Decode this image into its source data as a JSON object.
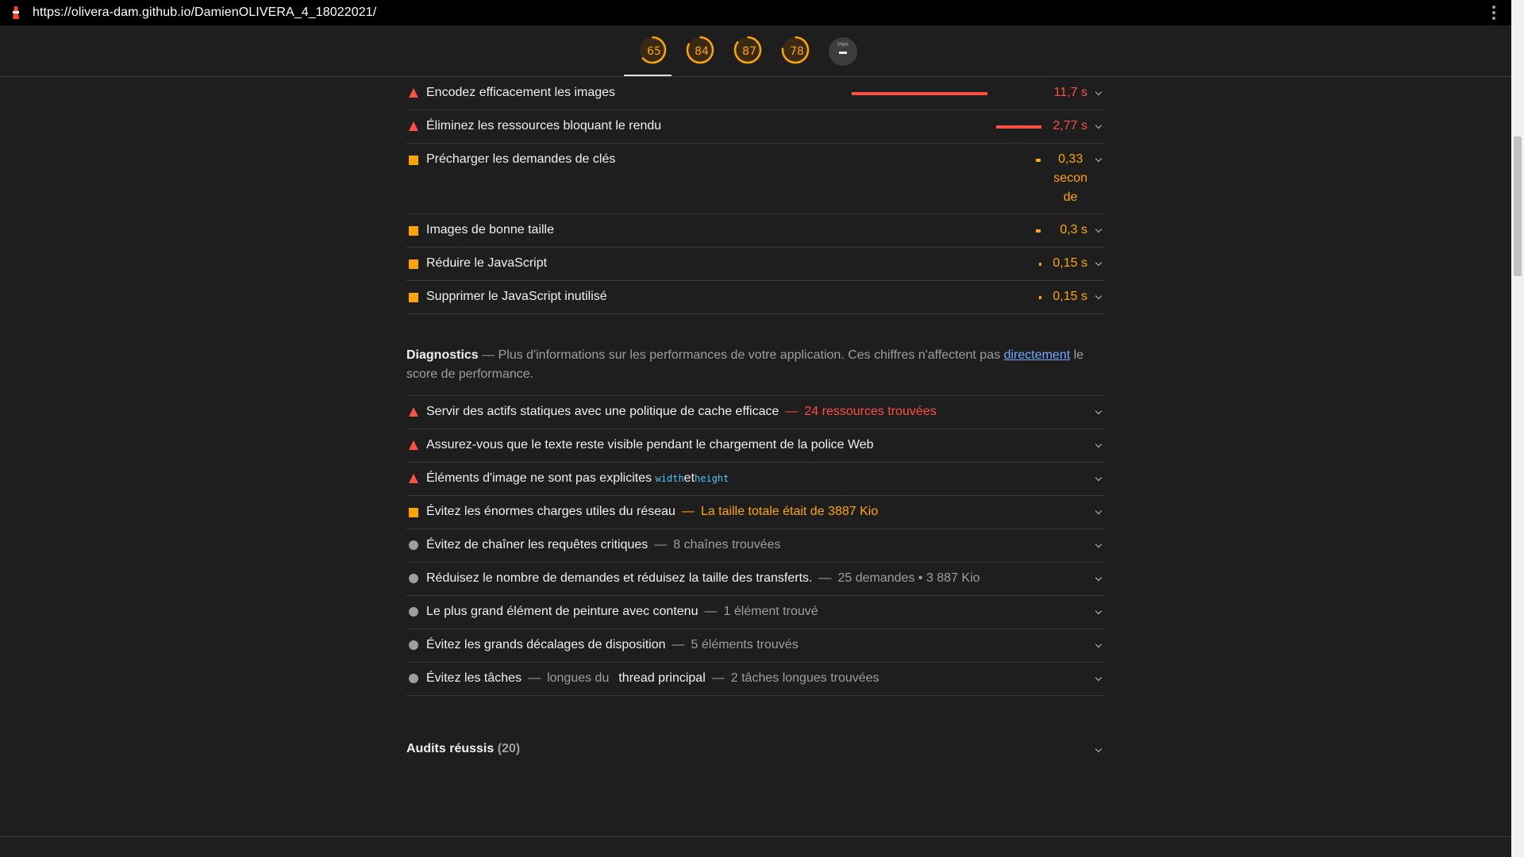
{
  "browser": {
    "url": "https://olivera-dam.github.io/DamienOLIVERA_4_18022021/",
    "logo_icon": "lighthouse-icon",
    "menu_icon": "kebab-menu-icon"
  },
  "gauges": [
    {
      "label": "65",
      "score": 65,
      "color": "#ffa400"
    },
    {
      "label": "84",
      "score": 84,
      "color": "#ffa400"
    },
    {
      "label": "87",
      "score": 87,
      "color": "#ffa400"
    },
    {
      "label": "78",
      "score": 78,
      "color": "#ffa400"
    },
    {
      "label": "PWA",
      "color": "#9e9e9e"
    }
  ],
  "opportunities": [
    {
      "icon": "fail-triangle-icon",
      "title": "Encodez efficacement les images",
      "value": "11,7 s",
      "severity": "red"
    },
    {
      "icon": "fail-triangle-icon",
      "title": "Éliminez les ressources bloquant le rendu",
      "value": "2,77 s",
      "severity": "red"
    },
    {
      "icon": "average-square-icon",
      "title": "Précharger les demandes de clés",
      "value": "0,33 seconde",
      "value_lines": [
        "0,33",
        "secon",
        "de"
      ],
      "severity": "orange"
    },
    {
      "icon": "average-square-icon",
      "title": "Images de bonne taille",
      "value": "0,3 s",
      "severity": "orange"
    },
    {
      "icon": "average-square-icon",
      "title": "Réduire le JavaScript",
      "value": "0,15 s",
      "severity": "orange"
    },
    {
      "icon": "average-square-icon",
      "title": "Supprimer le JavaScript inutilisé",
      "value": "0,15 s",
      "severity": "orange"
    }
  ],
  "diagnostics": {
    "heading": "Diagnostics",
    "dash": "—",
    "description_before": "Plus d'informations sur les performances de votre application. Ces chiffres n'affectent pas",
    "link": "directement",
    "description_after": "le score de performance.",
    "items": [
      {
        "icon": "fail-triangle-icon",
        "title": "Servir des actifs statiques avec une politique de cache efficace",
        "extra": "24 ressources trouvées",
        "extra_color": "red"
      },
      {
        "icon": "fail-triangle-icon",
        "title": "Assurez-vous que le texte reste visible pendant le chargement de la police Web"
      },
      {
        "icon": "fail-triangle-icon",
        "title": "Éléments d'image ne sont pas explicites",
        "code1": "width",
        "mid": "et",
        "code2": "height"
      },
      {
        "icon": "average-square-icon",
        "title": "Évitez les énormes charges utiles du réseau",
        "extra": "La taille totale était de 3887 Kio",
        "extra_color": "orange"
      },
      {
        "icon": "info-circle-icon",
        "title": "Évitez de chaîner les requêtes critiques",
        "extra": "8 chaînes trouvées",
        "extra_color": "gray"
      },
      {
        "icon": "info-circle-icon",
        "title": "Réduisez le nombre de demandes et réduisez la taille des transferts.",
        "extra": "25 demandes • 3 887 Kio",
        "extra_color": "gray"
      },
      {
        "icon": "info-circle-icon",
        "title": "Le plus grand élément de peinture avec contenu",
        "extra": "1 élément trouvé",
        "extra_color": "gray"
      },
      {
        "icon": "info-circle-icon",
        "title": "Évitez les grands décalages de disposition",
        "extra": "5 éléments trouvés",
        "extra_color": "gray"
      },
      {
        "icon": "info-circle-icon",
        "title": "Évitez les tâches",
        "mid_gray": "longues du",
        "title2": "thread principal",
        "extra": "2 tâches longues trouvées",
        "extra_color": "gray"
      }
    ]
  },
  "passed_audits": {
    "label": "Audits réussis",
    "count": "(20)"
  }
}
